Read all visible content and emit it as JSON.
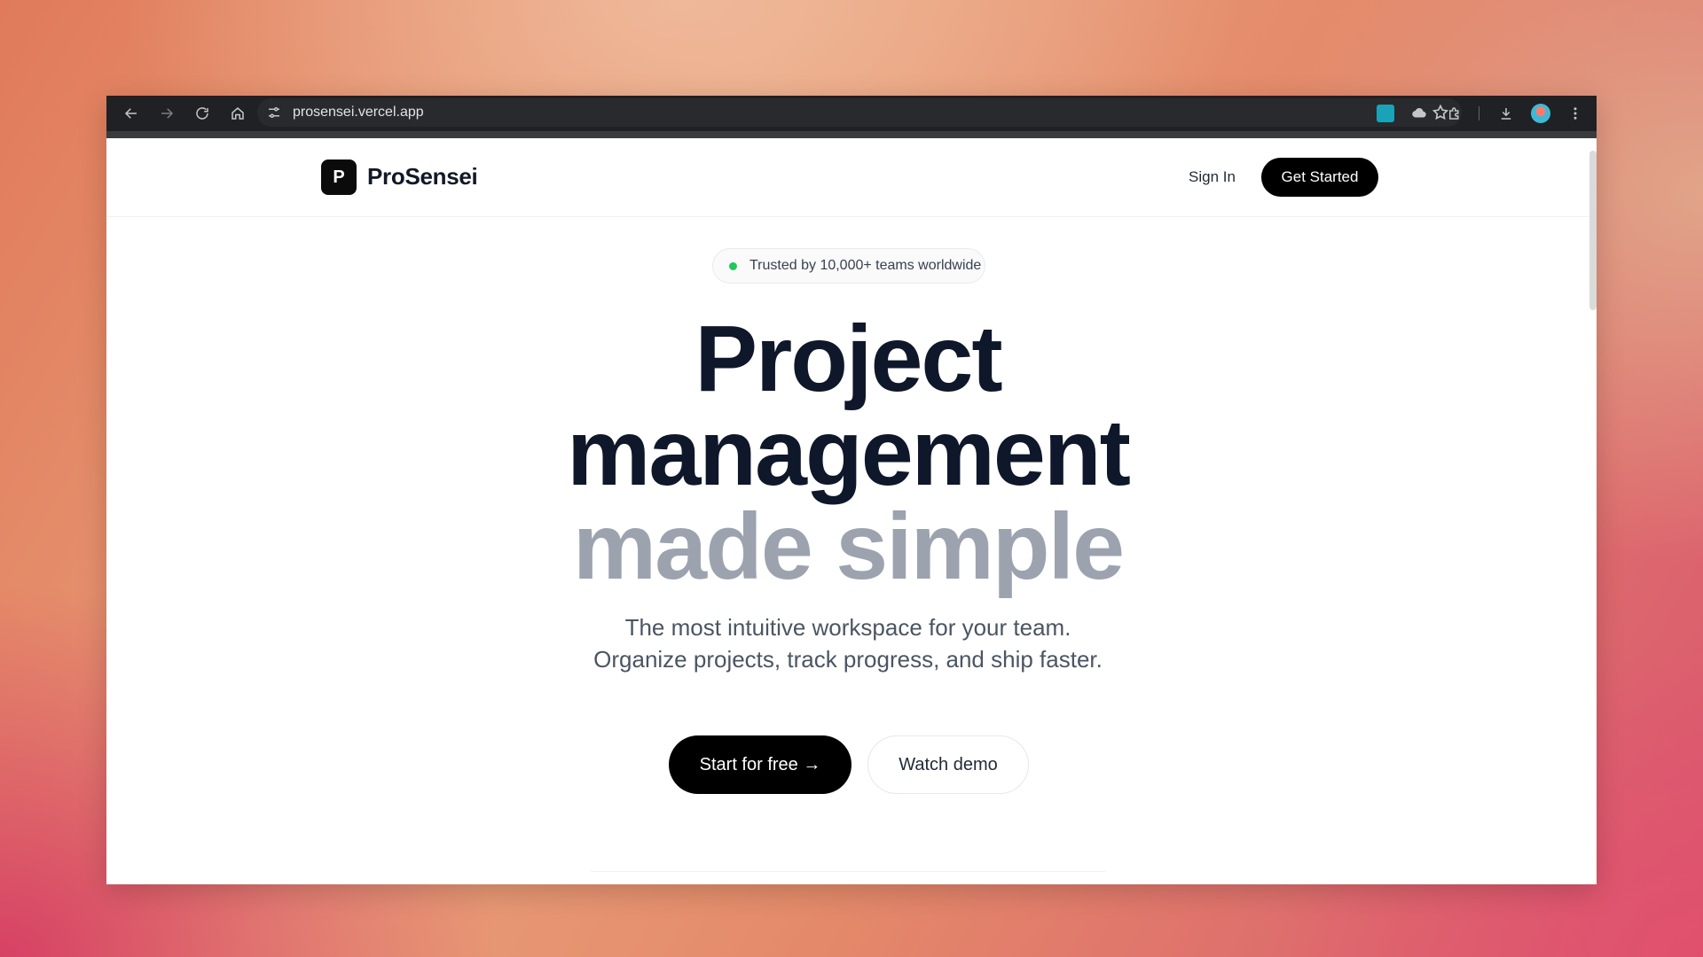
{
  "browser": {
    "url": "prosensei.vercel.app",
    "icons": [
      "back-arrow-icon",
      "forward-arrow-icon",
      "reload-icon",
      "home-icon",
      "site-settings-icon",
      "bookmark-star-icon",
      "extension-icon",
      "cloud-icon",
      "puzzle-icon",
      "download-icon",
      "profile-avatar",
      "kebab-menu-icon"
    ]
  },
  "navbar": {
    "logo_letter": "P",
    "brand": "ProSensei",
    "sign_in": "Sign In",
    "get_started": "Get Started"
  },
  "hero": {
    "badge_text": "Trusted by 10,000+ teams worldwide",
    "title_line1": "Project",
    "title_line2": "management",
    "title_line3": "made simple",
    "subtitle": "The most intuitive workspace for your team. Organize projects, track progress, and ship faster.",
    "cta_primary": "Start for free →",
    "cta_secondary": "Watch demo"
  },
  "colors": {
    "badge_dot": "#22c55e",
    "title_dark": "#0f172a",
    "title_muted": "#9ca3af",
    "button_black": "#000000"
  }
}
